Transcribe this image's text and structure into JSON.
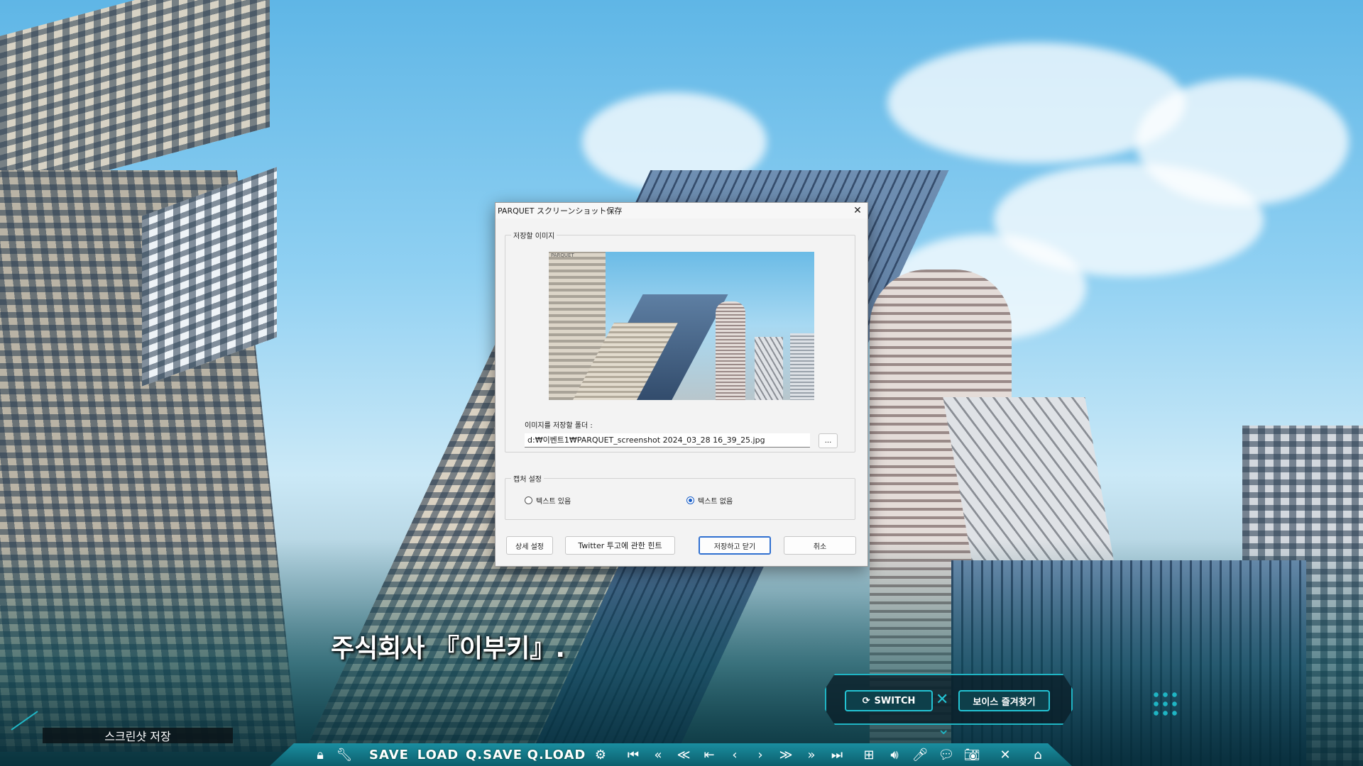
{
  "dialog": {
    "title": "PARQUET スクリーンショット保存",
    "image_group_label": "저장할 이미지",
    "preview_label": "PARQUET",
    "folder_label": "이미지를 저장할 폴더 :",
    "path_value": "d:₩이벤트1₩PARQUET_screenshot 2024_03_28 16_39_25.jpg",
    "browse_label": "...",
    "capture_group_label": "캡처 설정",
    "radio_with_text": "텍스트 있음",
    "radio_without_text": "텍스트 없음",
    "selected_radio": "without_text",
    "buttons": {
      "advanced": "상세 설정",
      "twitter_tips": "Twitter 투고에 관한 힌트",
      "save_close": "저장하고 닫기",
      "cancel": "취소"
    }
  },
  "game": {
    "dialogue_text": "주식회사 『이부키』.",
    "notice_text": "스크린샷 저장",
    "hud": {
      "switch_label": "SWITCH",
      "voice_fav_label": "보이스 즐겨찾기"
    },
    "toolbar": {
      "save": "SAVE",
      "load": "LOAD",
      "qsave": "Q.SAVE",
      "qload": "Q.LOAD"
    }
  },
  "colors": {
    "accent": "#1fb5c4",
    "primary_button_border": "#2f6fd0"
  }
}
